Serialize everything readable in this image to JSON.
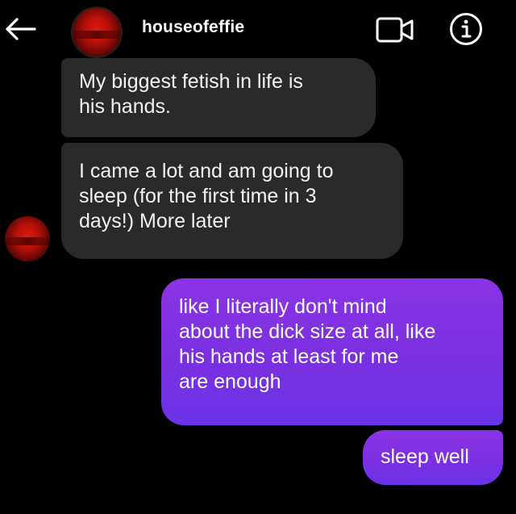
{
  "header": {
    "username": "houseofeffie",
    "icons": {
      "back": "back-arrow-icon",
      "video": "video-call-icon",
      "info": "info-icon"
    },
    "avatar_color": "#c4120b"
  },
  "messages": [
    {
      "direction": "incoming",
      "lines": [
        "My biggest fetish in life is",
        "his hands."
      ]
    },
    {
      "direction": "incoming",
      "lines": [
        "I came a lot and am going to",
        "sleep (for the first time in 3",
        "days!) More later"
      ]
    },
    {
      "direction": "outgoing",
      "lines": [
        "like I literally don't mind",
        "about the dick size at all, like",
        "his hands at least for me",
        "are enough"
      ]
    },
    {
      "direction": "outgoing",
      "lines": [
        "sleep well"
      ]
    }
  ],
  "colors": {
    "background": "#000000",
    "incoming_bubble": "#2a2a2a",
    "outgoing_bubble": "#7b30e0",
    "text": "#ffffff"
  }
}
